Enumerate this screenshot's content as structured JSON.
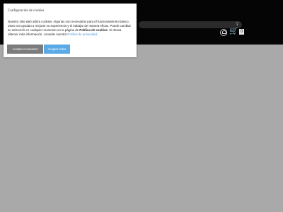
{
  "cookie_dialog": {
    "title": "Configuración de cookies",
    "text_1": "Nuestro sitio web utiliza cookies. Algunas son necesarias para el funcionamiento básico, otras nos ayudan a mejorar su experiencia y el trabajar de manera eficaz. Puede cambiar su selección en cualquier momento en la página de ",
    "policy_bold": "Política de cookies",
    "text_2": ". Si desea obtener más información, consulte nuestra ",
    "policy_link": "Política de privacidad",
    "text_3": ".",
    "accept_necessary_label": "Aceptar necesarios",
    "accept_all_label": "Aceptar todas"
  },
  "header": {
    "cart_count": "0",
    "icons": [
      "search-icon",
      "user-icon",
      "cart-icon"
    ],
    "colors": {
      "header_bg": "#050505",
      "overlay_bg": "#aaaaaa",
      "accept_all": "#5aaae6"
    }
  }
}
